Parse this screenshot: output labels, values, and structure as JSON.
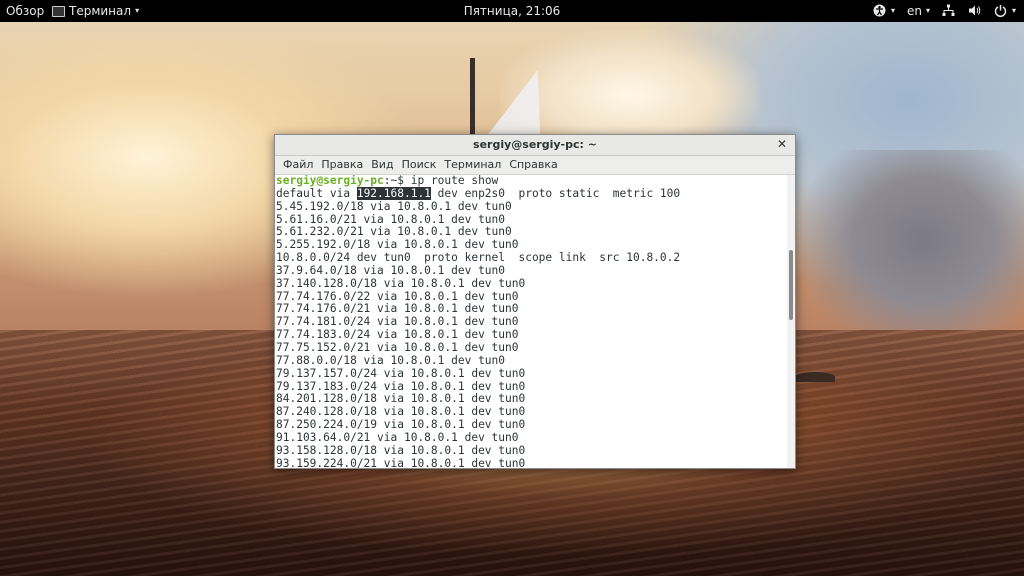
{
  "topbar": {
    "overview": "Обзор",
    "app_menu": "Терминал",
    "clock": "Пятница, 21:06",
    "language": "en",
    "icons": [
      "accessibility-icon",
      "network-icon",
      "volume-icon",
      "power-icon"
    ]
  },
  "window": {
    "title": "sergiy@sergiy-pc: ~",
    "menus": [
      "Файл",
      "Правка",
      "Вид",
      "Поиск",
      "Терминал",
      "Справка"
    ]
  },
  "terminal": {
    "prompt_user": "sergiy@sergiy-pc",
    "prompt_sep": ":~$ ",
    "command": "ip route show",
    "first_line_prefix": "default via ",
    "highlighted": "192.168.1.1",
    "first_line_suffix": " dev enp2s0  proto static  metric 100",
    "lines": [
      "5.45.192.0/18 via 10.8.0.1 dev tun0",
      "5.61.16.0/21 via 10.8.0.1 dev tun0",
      "5.61.232.0/21 via 10.8.0.1 dev tun0",
      "5.255.192.0/18 via 10.8.0.1 dev tun0",
      "10.8.0.0/24 dev tun0  proto kernel  scope link  src 10.8.0.2",
      "37.9.64.0/18 via 10.8.0.1 dev tun0",
      "37.140.128.0/18 via 10.8.0.1 dev tun0",
      "77.74.176.0/22 via 10.8.0.1 dev tun0",
      "77.74.176.0/21 via 10.8.0.1 dev tun0",
      "77.74.181.0/24 via 10.8.0.1 dev tun0",
      "77.74.183.0/24 via 10.8.0.1 dev tun0",
      "77.75.152.0/21 via 10.8.0.1 dev tun0",
      "77.88.0.0/18 via 10.8.0.1 dev tun0",
      "79.137.157.0/24 via 10.8.0.1 dev tun0",
      "79.137.183.0/24 via 10.8.0.1 dev tun0",
      "84.201.128.0/18 via 10.8.0.1 dev tun0",
      "87.240.128.0/18 via 10.8.0.1 dev tun0",
      "87.250.224.0/19 via 10.8.0.1 dev tun0",
      "91.103.64.0/21 via 10.8.0.1 dev tun0",
      "93.158.128.0/18 via 10.8.0.1 dev tun0",
      "93.159.224.0/21 via 10.8.0.1 dev tun0"
    ]
  }
}
